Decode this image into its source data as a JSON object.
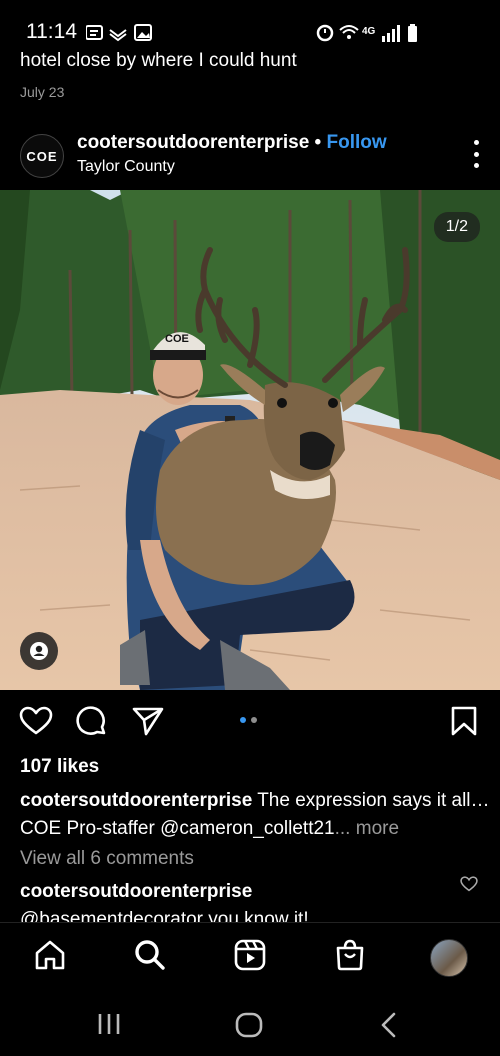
{
  "status_bar": {
    "time": "11:14"
  },
  "previous_post": {
    "caption_tail": "hotel close by where I could hunt",
    "date": "July 23"
  },
  "post": {
    "account": {
      "avatar_text": "COE",
      "username": "cootersoutdoorenterprise",
      "separator": "•",
      "follow_label": "Follow",
      "location": "Taylor County"
    },
    "media": {
      "counter": "1/2",
      "hat_logo": "COE"
    },
    "carousel": {
      "active_index": 0,
      "total": 2,
      "active_color": "#3897f0",
      "inactive_color": "#8e8e8e"
    },
    "likes": "107 likes",
    "caption": {
      "username": "cootersoutdoorenterprise",
      "text": " The expression says it all… COE Pro-staffer @cameron_collett21",
      "more": "... more"
    },
    "view_comments": "View all 6 comments",
    "top_comment": {
      "username": "cootersoutdoorenterprise",
      "text": "@basementdecorator you know it!"
    }
  },
  "icons": {
    "header_menu": "more-vertical-icon",
    "tag": "user-tag-icon",
    "like": "heart-icon",
    "comment": "comment-icon",
    "share": "send-icon",
    "save": "bookmark-icon",
    "comment_like": "small-heart-icon"
  },
  "bottom_nav": [
    "home-icon",
    "search-icon",
    "reels-icon",
    "shop-icon",
    "profile-avatar"
  ],
  "system_nav": [
    "recents-icon",
    "home-circle-icon",
    "back-icon"
  ]
}
